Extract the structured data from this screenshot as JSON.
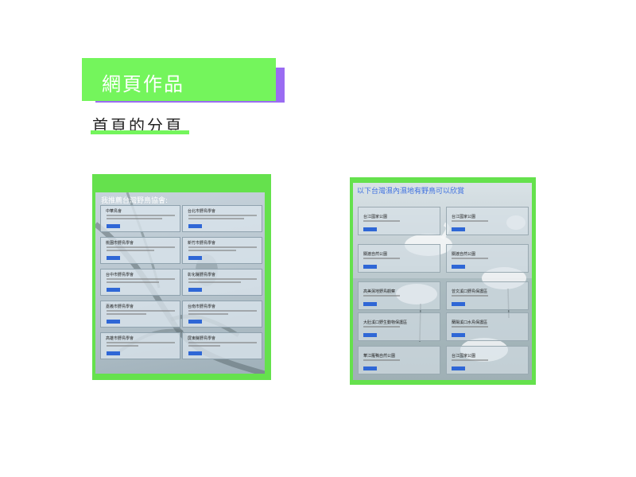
{
  "portfolio": {
    "title": "網頁作品",
    "subtitle": "首頁的分頁"
  },
  "colors": {
    "accent_green": "#74f55c",
    "accent_purple": "#9a6cf2",
    "link_blue": "#3d6fe0",
    "button_blue": "#2f67d6"
  },
  "left_shot": {
    "heading": "我推薦台灣野鳥協會:",
    "cards": [
      {
        "title": "中華鳥會"
      },
      {
        "title": "台北市野鳥學會"
      },
      {
        "title": "桃園市野鳥學會"
      },
      {
        "title": "新竹市野鳥學會"
      },
      {
        "title": "台中市野鳥學會"
      },
      {
        "title": "彰化縣野鳥學會"
      },
      {
        "title": "嘉義市野鳥學會"
      },
      {
        "title": "台南市野鳥學會"
      },
      {
        "title": "高雄市野鳥學會"
      },
      {
        "title": "屏東縣野鳥學會"
      }
    ]
  },
  "right_shot": {
    "heading": "以下台灣濕內濕地有野鳥可以欣賞",
    "cards": [
      {
        "title": "台江國家公園"
      },
      {
        "title": "台江國家公園"
      },
      {
        "title": "關渡自然公園"
      },
      {
        "title": "關渡自然公園"
      },
      {
        "title": "高美濕地野鳥觀察"
      },
      {
        "title": "曾文溪口野鳥保護區"
      },
      {
        "title": "大肚溪口野生動物保護區"
      },
      {
        "title": "蘭陽溪口水鳥保護區"
      },
      {
        "title": "華江雁鴨自然公園"
      },
      {
        "title": "台江國家公園"
      }
    ]
  }
}
